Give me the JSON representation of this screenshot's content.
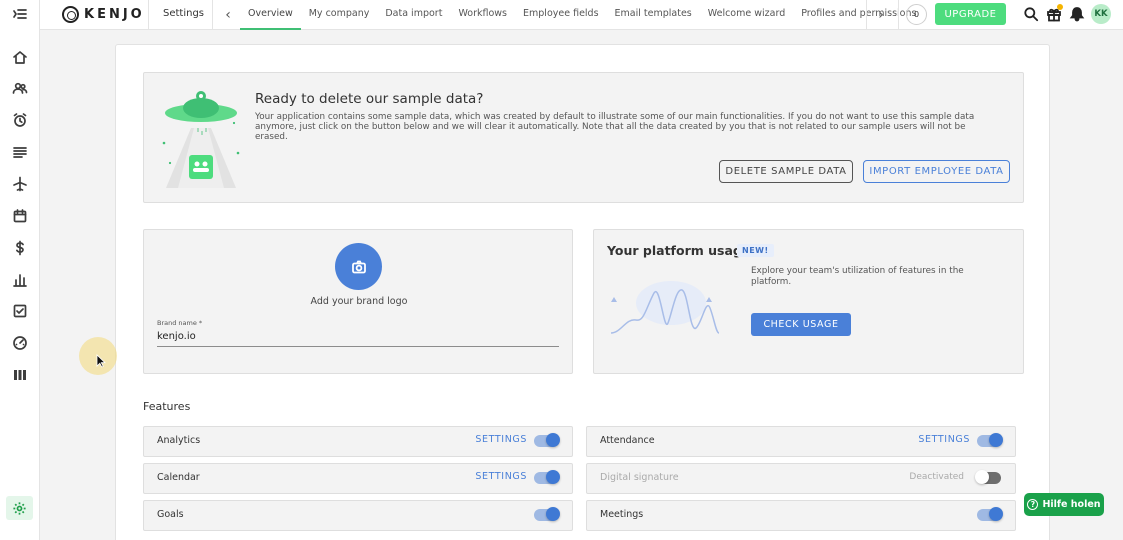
{
  "app": {
    "logo_text": "KENJO",
    "section_title": "Settings"
  },
  "header": {
    "tabs": [
      {
        "label": "Overview",
        "active": true
      },
      {
        "label": "My company"
      },
      {
        "label": "Data import"
      },
      {
        "label": "Workflows"
      },
      {
        "label": "Employee fields"
      },
      {
        "label": "Email templates"
      },
      {
        "label": "Welcome wizard"
      },
      {
        "label": "Profiles and permissions"
      }
    ],
    "counter": "0",
    "upgrade_label": "UPGRADE",
    "avatar_initials": "KK",
    "icons": [
      "search-icon",
      "gift-icon",
      "bell-icon"
    ],
    "notification_color": "#f5b400"
  },
  "sidebar": {
    "items": [
      "menu-toggle-icon",
      "home-icon",
      "people-icon",
      "alarm-clock-icon",
      "list-icon",
      "airplane-icon",
      "calendar-icon",
      "dollar-icon",
      "bar-chart-icon",
      "checkbox-icon",
      "gauge-icon",
      "columns-icon",
      "gear-icon"
    ],
    "active_item": "gear-icon"
  },
  "sample_data": {
    "title": "Ready to delete our sample data?",
    "text": "Your application contains some sample data, which was created by default to illustrate some of our main functionalities. If you do not want to use this sample data anymore, just click on the button below and we will clear it automatically. Note that all the data created by you that is not related to our sample users will not be erased.",
    "delete_label": "DELETE SAMPLE DATA",
    "import_label": "IMPORT EMPLOYEE DATA"
  },
  "brand": {
    "logo_label": "Add your brand logo",
    "field_label": "Brand name *",
    "field_value": "kenjo.io"
  },
  "usage": {
    "title": "Your platform usage",
    "badge": "NEW!",
    "text": "Explore your team's utilization of features in the platform.",
    "button_label": "CHECK USAGE"
  },
  "features": {
    "title": "Features",
    "items": [
      {
        "name": "Analytics",
        "link": "SETTINGS",
        "enabled": true
      },
      {
        "name": "Attendance",
        "link": "SETTINGS",
        "enabled": true
      },
      {
        "name": "Calendar",
        "link": "SETTINGS",
        "enabled": true
      },
      {
        "name": "Digital signature",
        "status": "Deactivated",
        "enabled": false
      },
      {
        "name": "Goals",
        "enabled": true
      },
      {
        "name": "Meetings",
        "enabled": true
      }
    ]
  },
  "help": {
    "label": "Hilfe holen"
  },
  "colors": {
    "accent_green": "#4ddc7e",
    "primary_blue": "#4a80d8",
    "help_green": "#1aa14a"
  }
}
